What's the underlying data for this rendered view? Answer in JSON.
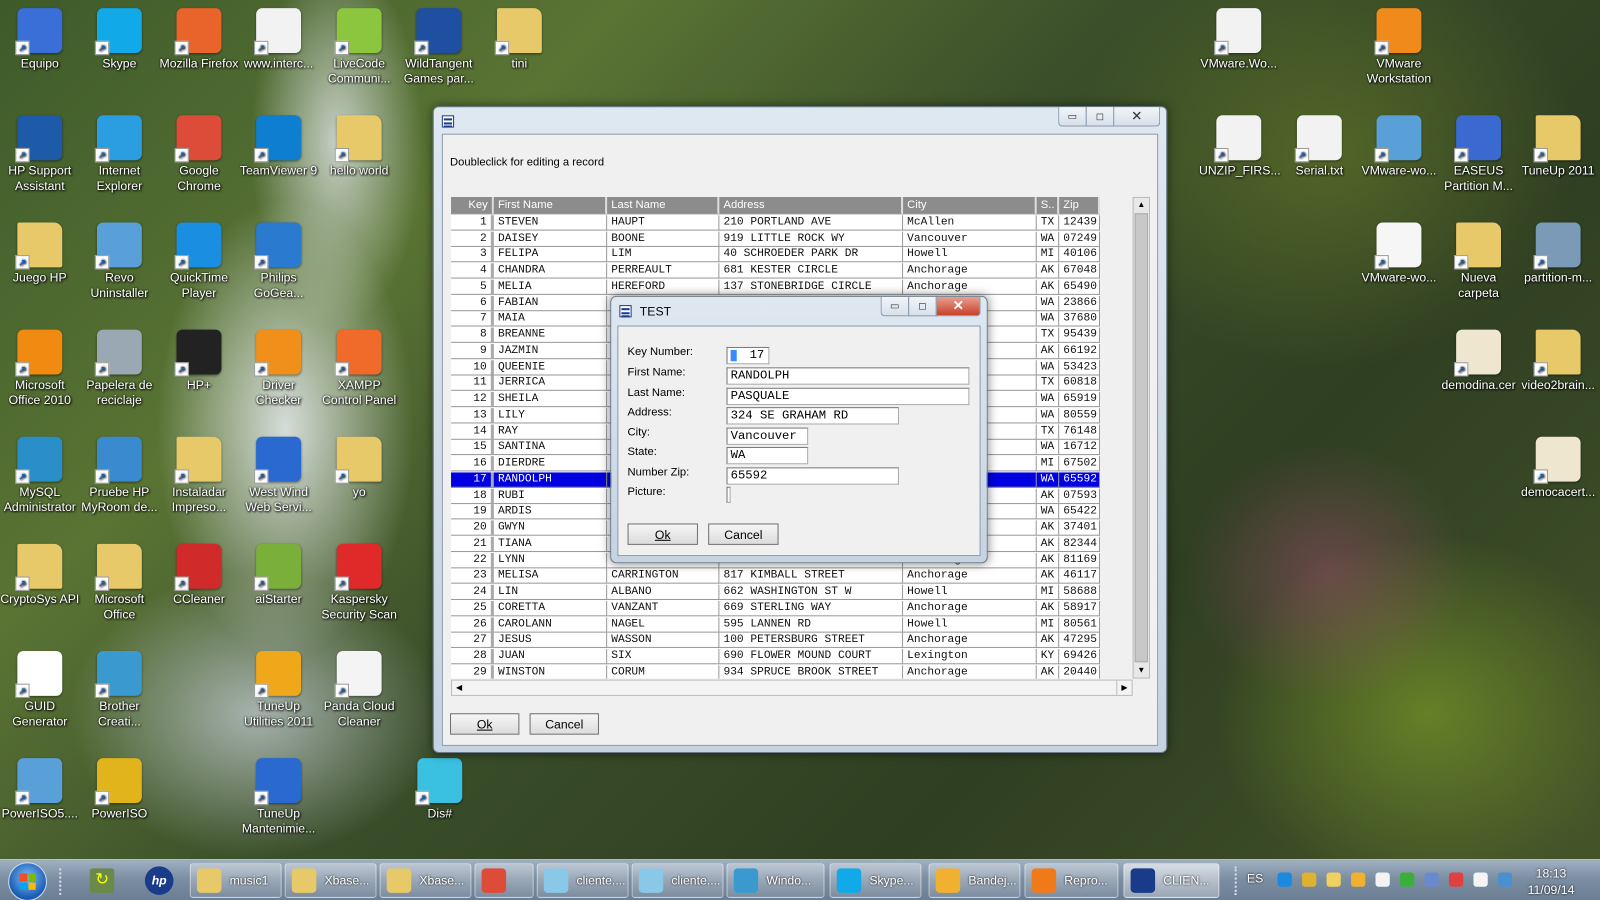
{
  "desktop_icons": [
    {
      "label": "Equipo",
      "icon": "computer-icon",
      "color": "#3a6fd8"
    },
    {
      "label": "Skype",
      "icon": "skype-icon",
      "color": "#12a9e8"
    },
    {
      "label": "Mozilla Firefox",
      "icon": "firefox-icon",
      "color": "#e8642a"
    },
    {
      "label": "www.interc...",
      "icon": "ie-document-icon",
      "color": "#f2f2f2"
    },
    {
      "label": "LiveCode Communi...",
      "icon": "livecode-icon",
      "color": "#8cc63f"
    },
    {
      "label": "WildTangent Games par...",
      "icon": "wildtangent-icon",
      "color": "#1f4fa0"
    },
    {
      "label": "tini",
      "icon": "folder-icon",
      "color": "#e8c96a"
    },
    {
      "label": "HP Support Assistant",
      "icon": "help-icon",
      "color": "#1d5aa8"
    },
    {
      "label": "Internet Explorer",
      "icon": "ie-icon",
      "color": "#2a9ee0"
    },
    {
      "label": "Google Chrome",
      "icon": "chrome-icon",
      "color": "#dd4b39"
    },
    {
      "label": "TeamViewer 9",
      "icon": "teamviewer-icon",
      "color": "#0e7fd0"
    },
    {
      "label": "hello world",
      "icon": "folder-icon",
      "color": "#e8c96a"
    },
    {
      "label": "Juego HP",
      "icon": "folder-icon",
      "color": "#e8c96a"
    },
    {
      "label": "Revo Uninstaller",
      "icon": "revo-icon",
      "color": "#5aa0d8"
    },
    {
      "label": "QuickTime Player",
      "icon": "quicktime-icon",
      "color": "#1a8ee0"
    },
    {
      "label": "Philips GoGea...",
      "icon": "philips-icon",
      "color": "#2a7ad0"
    },
    {
      "label": "Microsoft Office 2010",
      "icon": "office-icon",
      "color": "#f08a10"
    },
    {
      "label": "Papelera de reciclaje",
      "icon": "recycle-bin-icon",
      "color": "#9aa8b4"
    },
    {
      "label": "HP+",
      "icon": "hp-icon",
      "color": "#222222"
    },
    {
      "label": "Driver Checker",
      "icon": "driver-checker-icon",
      "color": "#f0901a"
    },
    {
      "label": "XAMPP Control Panel",
      "icon": "xampp-icon",
      "color": "#f06a2a"
    },
    {
      "label": "MySQL Administrator",
      "icon": "mysql-icon",
      "color": "#2a8ec8"
    },
    {
      "label": "Pruebe HP MyRoom de...",
      "icon": "myroom-icon",
      "color": "#3a8ad0"
    },
    {
      "label": "Instaladar Impreso...",
      "icon": "folder-icon",
      "color": "#e8c96a"
    },
    {
      "label": "West Wind Web Servi...",
      "icon": "westwind-icon",
      "color": "#2a6ad0"
    },
    {
      "label": "yo",
      "icon": "folder-icon",
      "color": "#e8c96a"
    },
    {
      "label": "CryptoSys API",
      "icon": "folder-icon",
      "color": "#e8c96a"
    },
    {
      "label": "Microsoft Office",
      "icon": "folder-icon",
      "color": "#e8c96a"
    },
    {
      "label": "CCleaner",
      "icon": "ccleaner-icon",
      "color": "#d02a2a"
    },
    {
      "label": "aiStarter",
      "icon": "android-icon",
      "color": "#7ab03a"
    },
    {
      "label": "Kaspersky Security Scan",
      "icon": "kaspersky-icon",
      "color": "#e02a2a"
    },
    {
      "label": "GUID Generator",
      "icon": "braces-icon",
      "color": "#ffffff"
    },
    {
      "label": "Brother Creati...",
      "icon": "brother-icon",
      "color": "#3a9ad0"
    },
    {
      "label": "TuneUp Utilities 2011",
      "icon": "tuneup-icon",
      "color": "#f0a81a"
    },
    {
      "label": "Panda Cloud Cleaner",
      "icon": "panda-icon",
      "color": "#f4f4f4"
    },
    {
      "label": "PowerISO5....",
      "icon": "installer-icon",
      "color": "#5aa0d8"
    },
    {
      "label": "PowerISO",
      "icon": "disc-icon",
      "color": "#e0b41a"
    },
    {
      "label": "TuneUp Mantenimie...",
      "icon": "tuneup-maint-icon",
      "color": "#2a6ad0"
    },
    {
      "label": "Dis#",
      "icon": "dissharp-icon",
      "color": "#3ac0e0"
    },
    {
      "label": "VMware.Wo...",
      "icon": "zip-icon",
      "color": "#f2f2f2"
    },
    {
      "label": "VMware Workstation",
      "icon": "vmware-icon",
      "color": "#f08a1a"
    },
    {
      "label": "UNZIP_FIRS...",
      "icon": "zip-icon",
      "color": "#f2f2f2"
    },
    {
      "label": "Serial.txt",
      "icon": "text-file-icon",
      "color": "#f2f2f2"
    },
    {
      "label": "VMware-wo...",
      "icon": "installer-icon",
      "color": "#5aa0d8"
    },
    {
      "label": "EASEUS Partition M...",
      "icon": "easeus-icon",
      "color": "#3a6ad0"
    },
    {
      "label": "TuneUp 2011",
      "icon": "folder-icon",
      "color": "#e8c96a"
    },
    {
      "label": "VMware-wo...",
      "icon": "blank-file-icon",
      "color": "#f6f6f6"
    },
    {
      "label": "Nueva carpeta",
      "icon": "folder-icon",
      "color": "#e8c96a"
    },
    {
      "label": "partition-m...",
      "icon": "setup-icon",
      "color": "#7a9ab8"
    },
    {
      "label": "demodina.cer",
      "icon": "certificate-icon",
      "color": "#efe6cf"
    },
    {
      "label": "video2brain...",
      "icon": "folder-icon",
      "color": "#e8c96a"
    },
    {
      "label": "democacert...",
      "icon": "certificate-icon",
      "color": "#efe6cf"
    }
  ],
  "main_window": {
    "title": "",
    "hint": "Doubleclick for editing a record",
    "columns": [
      "Key",
      "First Name",
      "Last Name",
      "Address",
      "City",
      "S..",
      "Zip"
    ],
    "selected_key": 17,
    "rows": [
      [
        "1",
        "STEVEN",
        "HAUPT",
        "210 PORTLAND AVE",
        "McAllen",
        "TX",
        "12439"
      ],
      [
        "2",
        "DAISEY",
        "BOONE",
        "919 LITTLE ROCK WY",
        "Vancouver",
        "WA",
        "07249"
      ],
      [
        "3",
        "FELIPA",
        "LIM",
        "40 SCHROEDER PARK DR",
        "Howell",
        "MI",
        "40106"
      ],
      [
        "4",
        "CHANDRA",
        "PERREAULT",
        "681 KESTER CIRCLE",
        "Anchorage",
        "AK",
        "67048"
      ],
      [
        "5",
        "MELIA",
        "HEREFORD",
        "137 STONEBRIDGE CIRCLE",
        "Anchorage",
        "AK",
        "65490"
      ],
      [
        "6",
        "FABIAN",
        "",
        "",
        "",
        "WA",
        "23866"
      ],
      [
        "7",
        "MAIA",
        "",
        "",
        "",
        "WA",
        "37680"
      ],
      [
        "8",
        "BREANNE",
        "",
        "",
        "",
        "TX",
        "95439"
      ],
      [
        "9",
        "JAZMIN",
        "",
        "",
        "",
        "AK",
        "66192"
      ],
      [
        "10",
        "QUEENIE",
        "",
        "",
        "",
        "WA",
        "53423"
      ],
      [
        "11",
        "JERRICA",
        "",
        "",
        "",
        "TX",
        "60818"
      ],
      [
        "12",
        "SHEILA",
        "",
        "",
        "",
        "WA",
        "65919"
      ],
      [
        "13",
        "LILY",
        "",
        "",
        "",
        "WA",
        "80559"
      ],
      [
        "14",
        "RAY",
        "",
        "",
        "",
        "TX",
        "76148"
      ],
      [
        "15",
        "SANTINA",
        "",
        "",
        "",
        "WA",
        "16712"
      ],
      [
        "16",
        "DIERDRE",
        "",
        "",
        "",
        "MI",
        "67502"
      ],
      [
        "17",
        "RANDOLPH",
        "",
        "",
        "",
        "WA",
        "65592"
      ],
      [
        "18",
        "RUBI",
        "",
        "",
        "",
        "AK",
        "07593"
      ],
      [
        "19",
        "ARDIS",
        "",
        "",
        "",
        "WA",
        "65422"
      ],
      [
        "20",
        "GWYN",
        "",
        "",
        "",
        "AK",
        "37401"
      ],
      [
        "21",
        "TIANA",
        "",
        "",
        "",
        "AK",
        "82344"
      ],
      [
        "22",
        "LYNN",
        "",
        "",
        "Anchorage",
        "AK",
        "81169"
      ],
      [
        "23",
        "MELISA",
        "CARRINGTON",
        "817 KIMBALL STREET",
        "Anchorage",
        "AK",
        "46117"
      ],
      [
        "24",
        "LIN",
        "ALBANO",
        "662 WASHINGTON ST W",
        "Howell",
        "MI",
        "58688"
      ],
      [
        "25",
        "CORETTA",
        "VANZANT",
        "669 STERLING WAY",
        "Anchorage",
        "AK",
        "58917"
      ],
      [
        "26",
        "CAROLANN",
        "NAGEL",
        "595 LANNEN RD",
        "Howell",
        "MI",
        "80561"
      ],
      [
        "27",
        "JESUS",
        "WASSON",
        "100 PETERSBURG STREET",
        "Anchorage",
        "AK",
        "47295"
      ],
      [
        "28",
        "JUAN",
        "SIX",
        "690 FLOWER MOUND COURT",
        "Lexington",
        "KY",
        "69426"
      ],
      [
        "29",
        "WINSTON",
        "CORUM",
        "934 SPRUCE BROOK STREET",
        "Anchorage",
        "AK",
        "20440"
      ]
    ],
    "ok_label": "Ok",
    "cancel_label": "Cancel"
  },
  "dialog": {
    "title": "TEST",
    "fields": [
      {
        "label": "Key Number:",
        "value": "17"
      },
      {
        "label": "First Name:",
        "value": "RANDOLPH"
      },
      {
        "label": "Last Name:",
        "value": "PASQUALE"
      },
      {
        "label": "Address:",
        "value": "324 SE GRAHAM RD"
      },
      {
        "label": "City:",
        "value": "Vancouver"
      },
      {
        "label": "State:",
        "value": "WA"
      },
      {
        "label": "Number Zip:",
        "value": "65592"
      },
      {
        "label": "Picture:",
        "value": ""
      }
    ],
    "ok_label": "Ok",
    "cancel_label": "Cancel"
  },
  "taskbar": {
    "pinned": [
      {
        "name": "start-button",
        "icon": "windows-logo-icon"
      },
      {
        "name": "pinned-app",
        "icon": "sync-icon"
      },
      {
        "name": "pinned-hp",
        "icon": "hp-icon"
      }
    ],
    "buttons": [
      {
        "label": "music1",
        "icon": "folder-icon",
        "color": "#e8c96a"
      },
      {
        "label": "Xbase...",
        "icon": "folder-icon",
        "color": "#e8c96a"
      },
      {
        "label": "Xbase...",
        "icon": "folder-icon",
        "color": "#e8c96a"
      },
      {
        "label": "",
        "icon": "chrome-icon",
        "color": "#dd4b39"
      },
      {
        "label": "cliente....",
        "icon": "notepad-icon",
        "color": "#8ac8e8"
      },
      {
        "label": "cliente....",
        "icon": "notepad-icon",
        "color": "#8ac8e8"
      },
      {
        "label": "Windo...",
        "icon": "messenger-icon",
        "color": "#3a9ad0"
      },
      {
        "label": "Skype...",
        "icon": "skype-icon",
        "color": "#12a9e8"
      },
      {
        "label": "Bandej...",
        "icon": "outlook-icon",
        "color": "#f0b030"
      },
      {
        "label": "Repro...",
        "icon": "media-player-icon",
        "color": "#f07a1a"
      },
      {
        "label": "CLIEN...",
        "icon": "app-window-icon",
        "color": "#1a3a8a"
      }
    ],
    "language": "ES",
    "tray_icons": [
      "sync-icon",
      "user-warning-icon",
      "mail-icon",
      "outlook-icon",
      "signal-icon",
      "green-shield-icon",
      "network-icon",
      "flag-error-icon",
      "volume-icon",
      "windows-update-icon"
    ],
    "time": "18:13",
    "date": "11/09/14"
  }
}
